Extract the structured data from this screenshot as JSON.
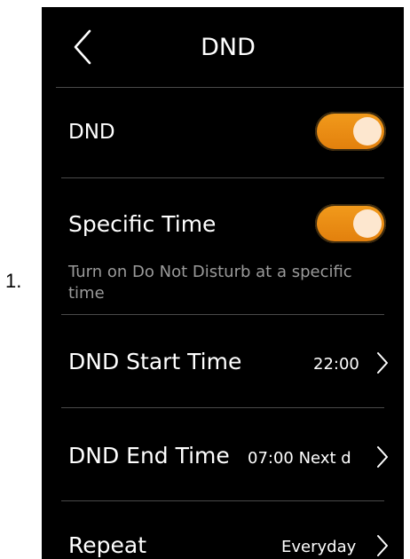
{
  "list_number": "1.",
  "header": {
    "title": "DND",
    "back_icon": "chevron-left-icon"
  },
  "rows": {
    "dnd": {
      "label": "DND",
      "enabled": true
    },
    "specific_time": {
      "label": "Specific Time",
      "enabled": true,
      "description": "Turn on Do Not Disturb at a specific time"
    },
    "start_time": {
      "label": "DND Start Time",
      "value": "22:00"
    },
    "end_time": {
      "label": "DND End Time",
      "value": "07:00 Next d"
    },
    "repeat": {
      "label": "Repeat",
      "value": "Everyday"
    }
  },
  "colors": {
    "background": "#000000",
    "accent": "#f29b1c",
    "divider": "#4a4a4a",
    "text": "#ffffff",
    "secondary_text": "#9a9a9a"
  }
}
